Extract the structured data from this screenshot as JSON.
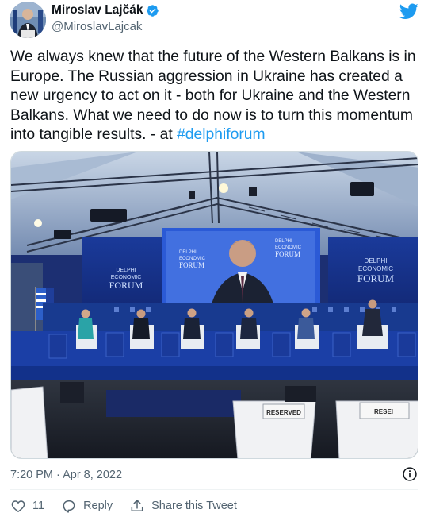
{
  "author": {
    "display_name": "Miroslav Lajčák",
    "handle": "@MiroslavLajcak",
    "verified": true
  },
  "tweet": {
    "text_main": "We always knew that the future of the Western Balkans is in Europe. The Russian aggression in Ukraine has created a new urgency to act on it - both for Ukraine and the Western Balkans. What we need to do now is to turn this momentum into tangible results. - at ",
    "hashtag": "#delphiforum"
  },
  "media": {
    "screen_brand_line1": "DELPHI",
    "screen_brand_line2": "ECONOMIC",
    "screen_brand_line3": "FORUM",
    "reserved_sign": "RESERVED",
    "reserved_sign_partial": "RESEI"
  },
  "timestamp": "7:20 PM · Apr 8, 2022",
  "actions": {
    "like_count": "11",
    "reply_label": "Reply",
    "share_label": "Share this Tweet"
  },
  "colors": {
    "accent": "#1d9bf0",
    "text": "#0f1419",
    "secondary": "#536471"
  },
  "icons": {
    "verified": "verified-badge-icon",
    "logo": "twitter-bird-icon",
    "info": "info-icon",
    "like": "heart-icon",
    "reply": "reply-bubble-icon",
    "share": "share-upload-icon"
  }
}
